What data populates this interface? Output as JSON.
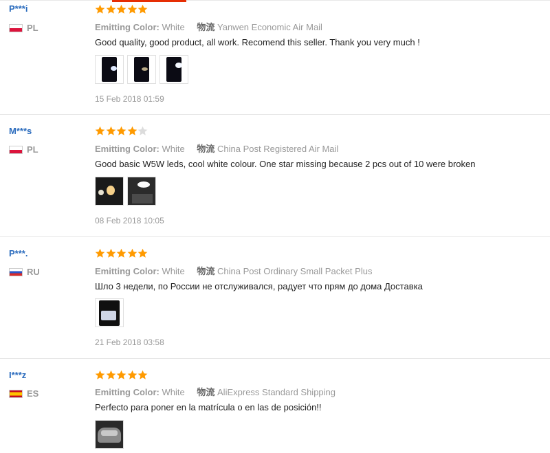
{
  "colors": {
    "accent": "#e62e04",
    "username": "#2a6bbd",
    "star": "#ff9a00",
    "star_empty": "#dcdcdc"
  },
  "labels": {
    "emitting_color": "Emitting Color:",
    "logistics": "物流"
  },
  "reviews": [
    {
      "user": "P***i",
      "country": "PL",
      "flag": "pl",
      "rating": 5,
      "color": "White",
      "shipping": "Yanwen Economic Air Mail",
      "text": "Good quality, good product, all work. Recomend this seller. Thank you very much !",
      "photos": [
        "dark-led-photo",
        "dark-led-photo",
        "dark-led-photo"
      ],
      "date": "15 Feb 2018 01:59"
    },
    {
      "user": "M***s",
      "country": "PL",
      "flag": "pl",
      "rating": 4,
      "color": "White",
      "shipping": "China Post Registered Air Mail",
      "text": "Good basic W5W leds, cool white colour. One star missing because 2 pcs out of 10 were broken",
      "photos": [
        "dark-led-photo",
        "dark-led-photo"
      ],
      "date": "08 Feb 2018 10:05"
    },
    {
      "user": "P***.",
      "country": "RU",
      "flag": "ru",
      "rating": 5,
      "color": "White",
      "shipping": "China Post Ordinary Small Packet Plus",
      "text": "Шло 3 недели, по России не отслуживался, радует что прям до дома Доставка",
      "photos": [
        "package-photo"
      ],
      "date": "21 Feb 2018 03:58"
    },
    {
      "user": "I***z",
      "country": "ES",
      "flag": "es",
      "rating": 5,
      "color": "White",
      "shipping": "AliExpress Standard Shipping",
      "text": "Perfecto para poner en la matrícula o en las de posición!!",
      "photos": [
        "car-photo"
      ],
      "date": ""
    }
  ]
}
